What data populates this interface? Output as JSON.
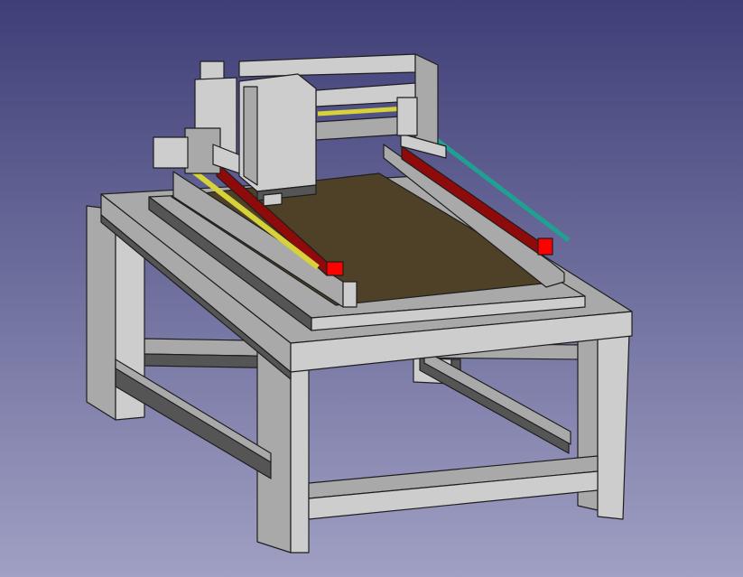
{
  "viewport": {
    "background_top": "#3f3f78",
    "background_bottom": "#a0a0c4"
  },
  "colors": {
    "frame_light": "#cdcdcd",
    "frame_mid": "#a9a9a9",
    "frame_dark": "#555555",
    "frame_outline": "#1e1e1e",
    "bed_surface": "#4e4128",
    "rail_red": "#8f0b0b",
    "end_block_red": "#ff0000",
    "lead_screw_yellow": "#d7d23a",
    "lead_screw_teal": "#1ea191"
  }
}
